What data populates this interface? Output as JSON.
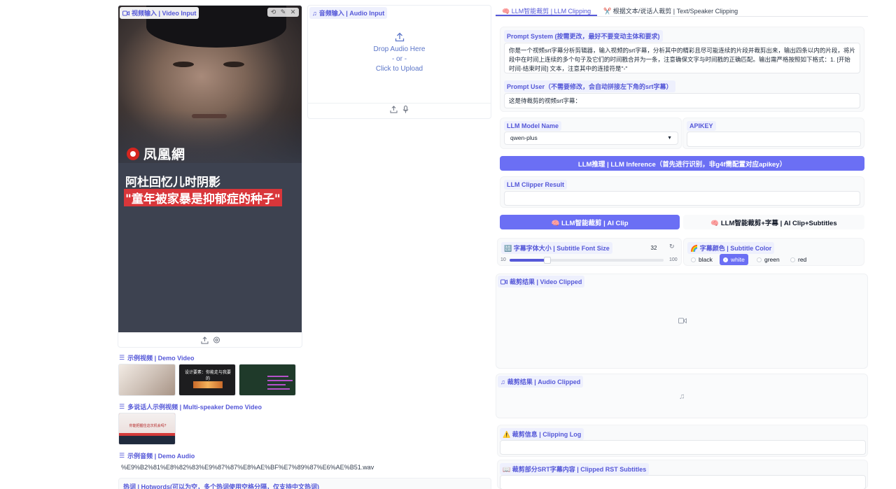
{
  "video_input": {
    "label": "视频输入 | Video Input",
    "tools": [
      "⟲",
      "✎",
      "✕"
    ],
    "logo_text": "凤凰網",
    "caption_line1": "阿杜回忆儿时阴影",
    "caption_line2": "\"童年被家暴是抑郁症的种子\""
  },
  "audio_input": {
    "label": "音频输入 | Audio Input",
    "drop_text": "Drop Audio Here",
    "or_text": "- or -",
    "click_text": "Click to Upload"
  },
  "demo": {
    "demo_video_title": "示例视频 | Demo Video",
    "thumb2_title": "设计要素：你能走与我要的",
    "multi_speaker_title": "多说话人示例视频 | Multi-speaker Demo Video",
    "thumb4_text": "你能把握住这次机会吗?",
    "demo_audio_title": "示例音频 | Demo Audio",
    "demo_audio_file": "%E9%B2%81%E8%82%83%E9%87%87%E8%AE%BF%E7%89%87%E6%AE%B51.wav",
    "hotwords_label": "热词 | Hotwords(可以为空，多个热词使用空格分隔，仅支持中文热词)"
  },
  "tabs": [
    {
      "label": "🧠 LLM智能裁剪 | LLM Clipping",
      "active": true
    },
    {
      "label": "✂️ 根据文本/说话人裁剪 | Text/Speaker Clipping",
      "active": false
    }
  ],
  "prompt_system": {
    "label": "Prompt System (按需更改，最好不要变动主体和要求)",
    "value": "你是一个视频srt字幕分析剪辑器，输入视频的srt字幕，分析其中的精彩且尽可能连续的片段并裁剪出来，输出四条以内的片段，将片段中在时间上连续的多个句子及它们的时间戳合并为一条，注意确保文字与时间戳的正确匹配。输出需严格按照如下格式：1. [开始时间-结束时间] 文本，注意其中的连接符是\"-\""
  },
  "prompt_user": {
    "label": "Prompt User（不需要修改，会自动拼接左下角的srt字幕）",
    "value": "这是待裁剪的视频srt字幕："
  },
  "llm_model": {
    "label": "LLM Model Name",
    "value": "qwen-plus"
  },
  "apikey": {
    "label": "APIKEY",
    "value": ""
  },
  "inference_button": "LLM推理 | LLM Inference（首先进行识别，非g4f需配置对应apikey）",
  "clipper_result": {
    "label": "LLM Clipper Result",
    "value": ""
  },
  "ai_clip_button": "🧠 LLM智能裁剪 | AI Clip",
  "ai_clip_sub_button": "🧠 LLM智能裁剪+字幕 | AI Clip+Subtitles",
  "font_size": {
    "label": "🔠 字幕字体大小 | Subtitle Font Size",
    "value": "32",
    "min": "10",
    "max": "100",
    "fraction": 0.244
  },
  "subtitle_color": {
    "label": "🌈 字幕颜色 | Subtitle Color",
    "options": [
      "black",
      "white",
      "green",
      "red"
    ],
    "selected": "white"
  },
  "video_clipped": {
    "label": "裁剪结果 | Video Clipped"
  },
  "audio_clipped": {
    "label": "裁剪结果 | Audio Clipped"
  },
  "clipping_log": {
    "label": "⚠️ 裁剪信息 | Clipping Log",
    "value": ""
  },
  "clipped_rst": {
    "label": "📖 裁剪部分SRT字幕内容 | Clipped RST Subtitles",
    "value": ""
  },
  "colors": {
    "accent": "#6b6ff4",
    "label_text": "#5558d8"
  }
}
